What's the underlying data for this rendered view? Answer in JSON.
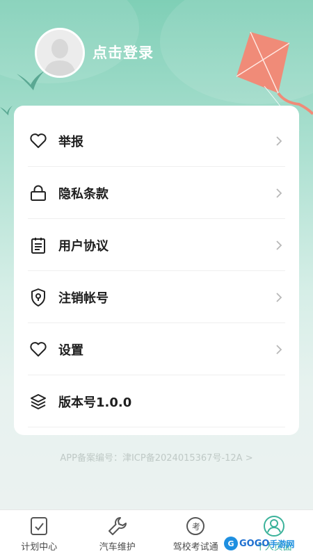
{
  "header": {
    "login_text": "点击登录"
  },
  "menu": {
    "items": [
      {
        "label": "举报",
        "icon": "heart-icon"
      },
      {
        "label": "隐私条款",
        "icon": "lock-icon"
      },
      {
        "label": "用户协议",
        "icon": "clipboard-icon"
      },
      {
        "label": "注销帐号",
        "icon": "shield-keyhole-icon"
      },
      {
        "label": "设置",
        "icon": "heart-icon"
      },
      {
        "label": "版本号1.0.0",
        "icon": "layers-icon"
      }
    ]
  },
  "footer": {
    "icp": "APP备案编号：津ICP备2024015367号-12A >"
  },
  "tabbar": {
    "tabs": [
      {
        "label": "计划中心",
        "icon": "plan-check-icon"
      },
      {
        "label": "汽车维护",
        "icon": "wrench-icon"
      },
      {
        "label": "驾校考试通",
        "icon": "exam-icon"
      },
      {
        "label": "个人页面",
        "icon": "person-icon"
      }
    ],
    "active_index": 3
  },
  "watermark": {
    "text": "GOGO",
    "sub": "手游网"
  },
  "colors": {
    "accent": "#3bb29a",
    "hero": "#7fcfb6",
    "kite": "#f08b78"
  }
}
